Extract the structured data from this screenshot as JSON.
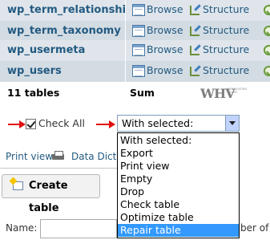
{
  "tables": [
    {
      "name": "wp_term_relationships",
      "browse": "Browse",
      "structure": "Structure"
    },
    {
      "name": "wp_term_taxonomy",
      "browse": "Browse",
      "structure": "Structure"
    },
    {
      "name": "wp_usermeta",
      "browse": "Browse",
      "structure": "Structure"
    },
    {
      "name": "wp_users",
      "browse": "Browse",
      "structure": "Structure"
    }
  ],
  "icons": {
    "browse": "browse-table-icon",
    "structure": "structure-icon",
    "search": "search-icon"
  },
  "footer": {
    "count": "11 tables",
    "sum": "Sum"
  },
  "watermark": {
    "mark": "WHV",
    "tag": "WEB HOSTING TALENT"
  },
  "bulk": {
    "check_all": "Check All",
    "selected_value": "With selected:"
  },
  "dropdown": {
    "options": [
      "With selected:",
      "Export",
      "Print view",
      "Empty",
      "Drop",
      "Check table",
      "Optimize table",
      "Repair table"
    ],
    "highlighted": "Repair table"
  },
  "links": {
    "print_view": "Print view",
    "data_dict": "Data Dict"
  },
  "create": {
    "button": "Create table",
    "name_label": "Name:",
    "num_columns_label": "ber of"
  },
  "colors": {
    "row_odd": "#d3dce3",
    "row_even": "#dfe5eb",
    "link": "#235a81",
    "highlight": "#3399ff",
    "annotation_arrow": "#e01010"
  }
}
